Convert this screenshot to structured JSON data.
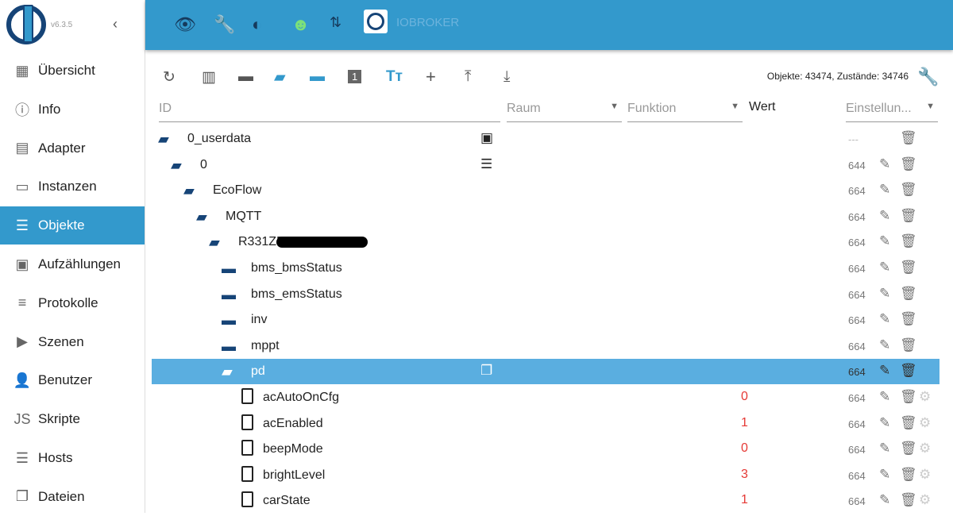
{
  "sidebar": {
    "version": "v6.3.5",
    "items": [
      {
        "label": "Übersicht",
        "icon": "grid-icon",
        "glyph": "▦"
      },
      {
        "label": "Info",
        "icon": "info-icon",
        "glyph": "ⓘ"
      },
      {
        "label": "Adapter",
        "icon": "store-icon",
        "glyph": "▤"
      },
      {
        "label": "Instanzen",
        "icon": "instances-icon",
        "glyph": "▭"
      },
      {
        "label": "Objekte",
        "icon": "list-icon",
        "glyph": "☰",
        "selected": true
      },
      {
        "label": "Aufzählungen",
        "icon": "enum-icon",
        "glyph": "▣"
      },
      {
        "label": "Protokolle",
        "icon": "logs-icon",
        "glyph": "≡"
      },
      {
        "label": "Szenen",
        "icon": "scenes-icon",
        "glyph": "▶"
      },
      {
        "label": "Benutzer",
        "icon": "user-icon",
        "glyph": "👤"
      },
      {
        "label": "Skripte",
        "icon": "js-icon",
        "glyph": "JS"
      },
      {
        "label": "Hosts",
        "icon": "hosts-icon",
        "glyph": "☰"
      },
      {
        "label": "Dateien",
        "icon": "files-icon",
        "glyph": "❐"
      }
    ]
  },
  "header": {
    "title": "IOBROKER"
  },
  "toolbar": {
    "stats": "Objekte: 43474, Zustände: 34746"
  },
  "columns": {
    "id": "ID",
    "room": "Raum",
    "function": "Funktion",
    "value": "Wert",
    "settings": "Einstellun..."
  },
  "rows": [
    {
      "name": "0_userdata",
      "level": 0,
      "type": "folder-open",
      "perm": "---",
      "extra": "image"
    },
    {
      "name": "0",
      "level": 1,
      "type": "folder-open",
      "perm": "644",
      "extra": "doc"
    },
    {
      "name": "EcoFlow",
      "level": 2,
      "type": "folder-open",
      "perm": "664"
    },
    {
      "name": "MQTT",
      "level": 3,
      "type": "folder-open",
      "perm": "664"
    },
    {
      "name": "R331ZE",
      "level": 4,
      "type": "folder-open",
      "perm": "664",
      "redacted": true
    },
    {
      "name": "bms_bmsStatus",
      "level": 5,
      "type": "folder",
      "perm": "664"
    },
    {
      "name": "bms_emsStatus",
      "level": 5,
      "type": "folder",
      "perm": "664"
    },
    {
      "name": "inv",
      "level": 5,
      "type": "folder",
      "perm": "664"
    },
    {
      "name": "mppt",
      "level": 5,
      "type": "folder",
      "perm": "664"
    },
    {
      "name": "pd",
      "level": 5,
      "type": "folder-open",
      "perm": "664",
      "selected": true,
      "extra": "copy"
    },
    {
      "name": "acAutoOnCfg",
      "level": 6,
      "type": "state",
      "perm": "664",
      "value": "0"
    },
    {
      "name": "acEnabled",
      "level": 6,
      "type": "state",
      "perm": "664",
      "value": "1"
    },
    {
      "name": "beepMode",
      "level": 6,
      "type": "state",
      "perm": "664",
      "value": "0"
    },
    {
      "name": "brightLevel",
      "level": 6,
      "type": "state",
      "perm": "664",
      "value": "3"
    },
    {
      "name": "carState",
      "level": 6,
      "type": "state",
      "perm": "664",
      "value": "1"
    }
  ]
}
